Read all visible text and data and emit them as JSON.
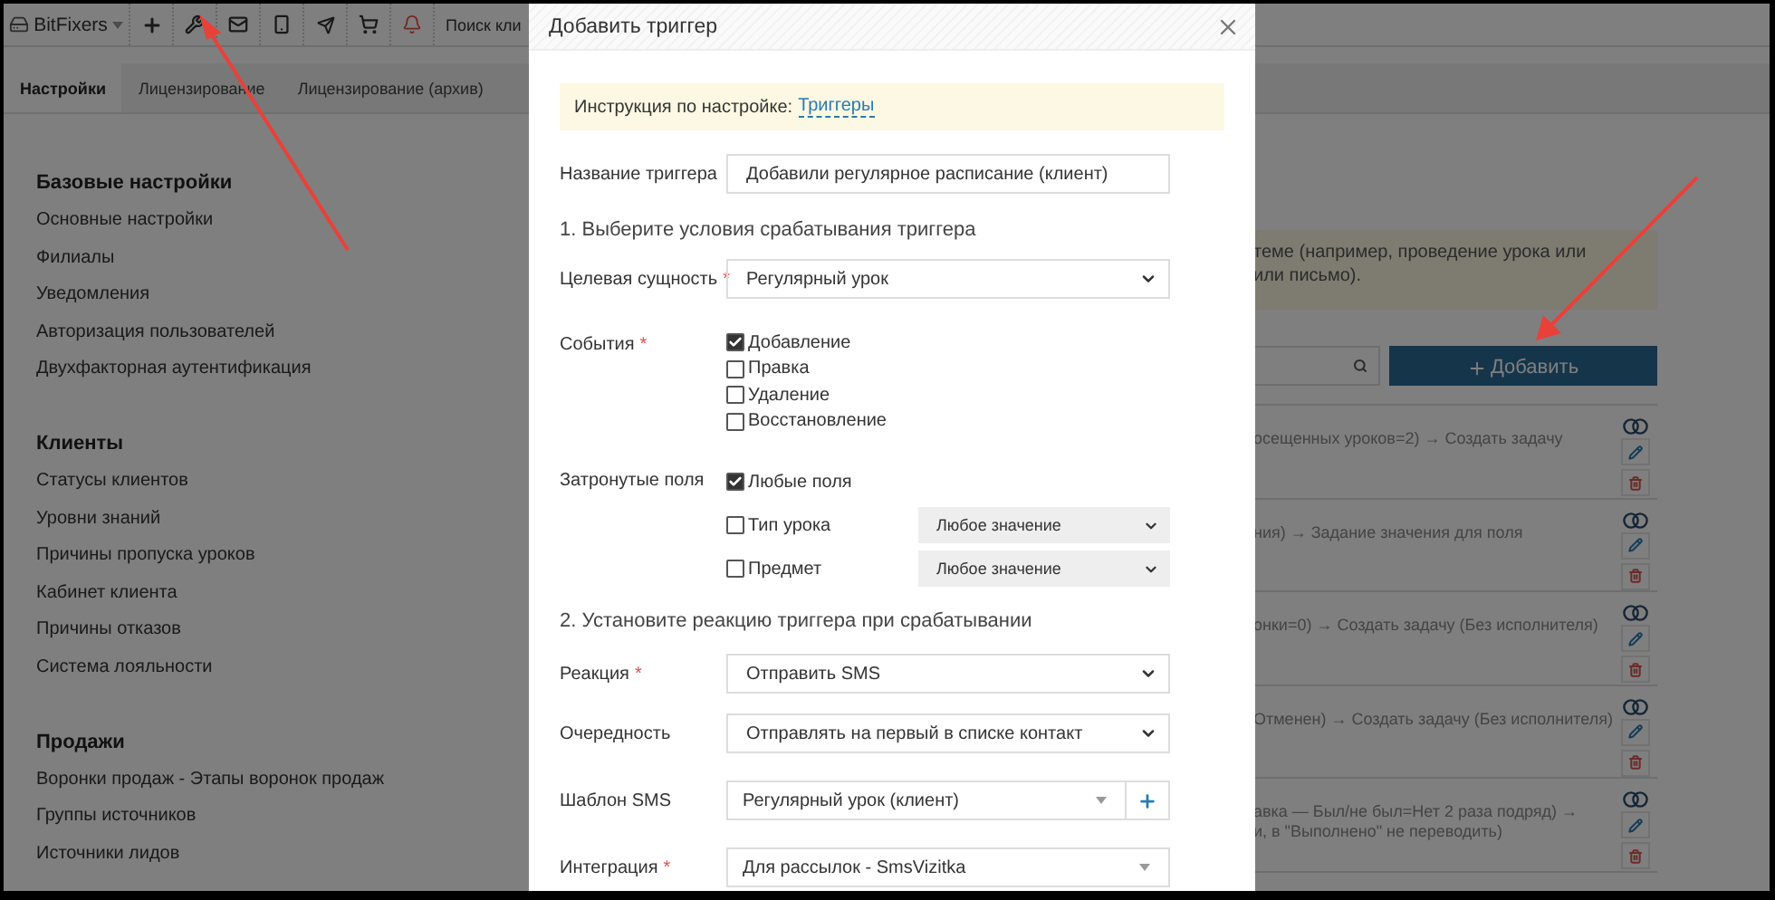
{
  "topbar": {
    "brand": "BitFixers",
    "search_placeholder": "Поиск кли"
  },
  "tabs": [
    {
      "label": "Настройки",
      "selected": true
    },
    {
      "label": "Лицензирование",
      "selected": false
    },
    {
      "label": "Лицензирование (архив)",
      "selected": false
    }
  ],
  "sidebar": {
    "sections": [
      {
        "title": "Базовые настройки",
        "items": [
          "Основные настройки",
          "Филиалы",
          "Уведомления",
          "Авторизация пользователей",
          "Двухфакторная аутентификация"
        ]
      },
      {
        "title": "Клиенты",
        "items": [
          "Статусы клиентов",
          "Уровни знаний",
          "Причины пропуска уроков",
          "Кабинет клиента",
          "Причины отказов",
          "Система лояльности"
        ]
      },
      {
        "title": "Продажи",
        "items": [
          "Воронки продаж - Этапы воронок продаж",
          "Группы источников",
          "Источники лидов"
        ]
      }
    ]
  },
  "notice": {
    "lines": [
      "теме (например, проведение урока или",
      "или письмо)."
    ]
  },
  "add_button": {
    "label": "Добавить"
  },
  "rules": [
    {
      "lines": [
        "осещенных уроков=2) → Создать задачу"
      ]
    },
    {
      "lines": [
        "ния) → Задание значения для поля"
      ]
    },
    {
      "lines": [
        "онки=0) → Создать задачу (Без исполнителя)"
      ]
    },
    {
      "lines": [
        "Отменен) → Создать задачу (Без исполнителя)"
      ]
    },
    {
      "lines": [
        "авка — Был/не был=Нет 2 раза подряд) →",
        "и, в \"Выполнено\" не переводить)"
      ]
    }
  ],
  "modal": {
    "title": "Добавить триггер",
    "instruction": {
      "text": "Инструкция по настройке:",
      "link": "Триггеры"
    },
    "name_field": {
      "label": "Название триггера",
      "value": "Добавили регулярное расписание (клиент)"
    },
    "section_1": "1. Выберите условия срабатывания триггера",
    "target_entity": {
      "label": "Целевая сущность",
      "marker": "*",
      "value": "Регулярный урок"
    },
    "events": {
      "label": "События",
      "marker": "*",
      "options": [
        {
          "label": "Добавление",
          "checked": true
        },
        {
          "label": "Правка",
          "checked": false
        },
        {
          "label": "Удаление",
          "checked": false
        },
        {
          "label": "Восстановление",
          "checked": false
        }
      ]
    },
    "affected_fields": {
      "label": "Затронутые поля",
      "options": [
        {
          "kind": "checkbox",
          "label": "Любые поля",
          "checked": true
        },
        {
          "kind": "checkbox_select",
          "label": "Тип урока",
          "checked": false,
          "value": "Любое значение"
        },
        {
          "kind": "checkbox_select",
          "label": "Предмет",
          "checked": false,
          "value": "Любое значение"
        }
      ]
    },
    "section_2": "2. Установите реакцию триггера при срабатывании",
    "reaction_fields": [
      {
        "kind": "select",
        "label": "Реакция",
        "marker": "*",
        "value": "Отправить SMS"
      },
      {
        "kind": "select",
        "label": "Очередность",
        "value": "Отправлять на первый в списке контакт"
      },
      {
        "kind": "combo",
        "label": "Шаблон SMS",
        "value": "Регулярный урок (клиент)",
        "add_button": true
      },
      {
        "kind": "combo",
        "label": "Интеграция",
        "marker": "*",
        "value": "Для рассылок - SmsVizitka",
        "add_button": false
      }
    ]
  }
}
